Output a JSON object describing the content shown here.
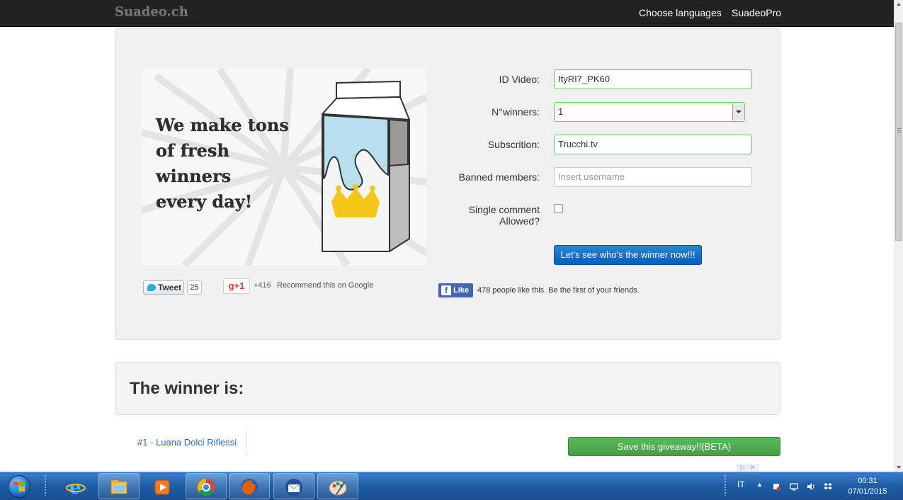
{
  "navbar": {
    "brand": "Suadeo.ch",
    "links": [
      "Choose languages",
      "SuadeoPro"
    ]
  },
  "hero": {
    "tagline_lines": [
      "We make tons",
      "of fresh",
      "winners",
      "every day!"
    ]
  },
  "form": {
    "id_video": {
      "label": "ID Video:",
      "value": "ItyRI7_PK60"
    },
    "winners": {
      "label": "N°winners:",
      "value": "1"
    },
    "subscription": {
      "label": "Subscrition:",
      "value": "Trucchi.tv"
    },
    "banned": {
      "label": "Banned members:",
      "placeholder": "Insert username"
    },
    "single_comment": {
      "label_line1": "Single comment",
      "label_line2": "Allowed?",
      "checked": false
    },
    "submit_label": "Let's see who's the winner now!!!"
  },
  "social": {
    "tweet_label": "Tweet",
    "tweet_count": "25",
    "gplus_label": "g+1",
    "gplus_count": "+416",
    "gplus_text": "Recommend this on Google",
    "fb_label": "Like",
    "fb_text": "478 people like this. Be the first of your friends."
  },
  "winner": {
    "title": "The winner is:",
    "entry": "#1 - Luana Dolci Riflessi",
    "save_label": "Save this giveaway!!(BETA)"
  },
  "taskbar": {
    "apps": [
      "start-icon",
      "ie-icon",
      "explorer-icon",
      "media-player-icon",
      "chrome-icon",
      "firefox-icon",
      "thunderbird-icon",
      "paint-icon"
    ],
    "language": "IT",
    "time": "00:31",
    "date": "07/01/2015"
  },
  "colors": {
    "navbar": "#222222",
    "input_valid_border": "#5cd65c",
    "primary_button": "#0a5cb8",
    "success_button": "#5cb85c",
    "link": "#2a6fb8"
  }
}
